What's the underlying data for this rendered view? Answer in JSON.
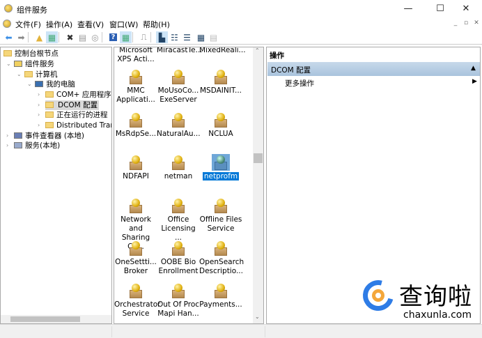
{
  "window": {
    "title": "组件服务",
    "minimize": "—",
    "maximize": "☐",
    "close": "✕"
  },
  "menu": [
    "文件(F)",
    "操作(A)",
    "查看(V)",
    "窗口(W)",
    "帮助(H)"
  ],
  "mdi": {
    "minimize": "_",
    "restore": "▫",
    "close": "✕"
  },
  "toolbar": [
    {
      "icon": "back-icon",
      "glyph": "⬅",
      "color": "#3a8ee6"
    },
    {
      "icon": "forward-icon",
      "glyph": "➡",
      "color": "#888"
    },
    {
      "icon": "up-folder-icon",
      "glyph": "▲",
      "color": "#e2b33c"
    },
    {
      "icon": "show-hide-tree-icon",
      "glyph": "▦",
      "color": "#4a7",
      "on": true
    },
    {
      "icon": "delete-icon",
      "glyph": "✖",
      "color": "#333"
    },
    {
      "icon": "properties-icon",
      "glyph": "▤",
      "color": "#999"
    },
    {
      "icon": "refresh-icon",
      "glyph": "◎",
      "color": "#999"
    },
    {
      "icon": "help-icon",
      "glyph": "?",
      "color": "#fff",
      "bg": "#2b5fb3"
    },
    {
      "icon": "show-action-pane-icon",
      "glyph": "▦",
      "color": "#4a7",
      "on": true
    },
    {
      "icon": "export-icon",
      "glyph": "⎍",
      "color": "#777"
    },
    {
      "icon": "large-icons-view-icon",
      "glyph": "▙",
      "color": "#246",
      "on": true
    },
    {
      "icon": "small-icons-view-icon",
      "glyph": "☷",
      "color": "#246"
    },
    {
      "icon": "list-view-icon",
      "glyph": "☰",
      "color": "#246"
    },
    {
      "icon": "detail-view-icon",
      "glyph": "▦",
      "color": "#246"
    },
    {
      "icon": "configure-icon",
      "glyph": "▤",
      "color": "#bbb"
    }
  ],
  "tree": [
    {
      "label": "控制台根节点",
      "level": 0,
      "arrow": ""
    },
    {
      "label": "组件服务",
      "level": 1,
      "arrow": "⌄"
    },
    {
      "label": "计算机",
      "level": 2,
      "arrow": "⌄"
    },
    {
      "label": "我的电脑",
      "level": 3,
      "arrow": "⌄"
    },
    {
      "label": "COM+ 应用程序",
      "level": 4,
      "arrow": "›"
    },
    {
      "label": "DCOM 配置",
      "level": 4,
      "arrow": "›",
      "selected": true
    },
    {
      "label": "正在运行的进程",
      "level": 4,
      "arrow": "›"
    },
    {
      "label": "Distributed Trans",
      "level": 4,
      "arrow": "›"
    },
    {
      "label": "事件查看器 (本地)",
      "level": 1,
      "arrow": "›"
    },
    {
      "label": "服务(本地)",
      "level": 1,
      "arrow": "›"
    }
  ],
  "items": [
    {
      "l1": "Microsoft",
      "l2": "XPS Acti...",
      "noicon": true
    },
    {
      "l1": "MiracastTe...",
      "l2": "",
      "noicon": true
    },
    {
      "l1": "MixedReali...",
      "l2": "",
      "noicon": true
    },
    {
      "l1": "MMC",
      "l2": "Applicati..."
    },
    {
      "l1": "MoUsoCo...",
      "l2": "ExeServer"
    },
    {
      "l1": "MSDAINIT...",
      "l2": ""
    },
    {
      "l1": "MsRdpSe...",
      "l2": ""
    },
    {
      "l1": "NaturalAu...",
      "l2": ""
    },
    {
      "l1": "NCLUA",
      "l2": ""
    },
    {
      "l1": "NDFAPI",
      "l2": ""
    },
    {
      "l1": "netman",
      "l2": ""
    },
    {
      "l1": "netprofm",
      "l2": "",
      "selected": true
    },
    {
      "l1": "Network and",
      "l2": "Sharing Ce..."
    },
    {
      "l1": "Office",
      "l2": "Licensing ..."
    },
    {
      "l1": "Offline Files",
      "l2": "Service"
    },
    {
      "l1": "OneSettti...",
      "l2": "Broker"
    },
    {
      "l1": "OOBE Bio",
      "l2": "Enrollment"
    },
    {
      "l1": "OpenSearch",
      "l2": "Descriptio..."
    },
    {
      "l1": "Orchestrator",
      "l2": "Service"
    },
    {
      "l1": "Out Of Proc",
      "l2": "Mapi Han..."
    },
    {
      "l1": "Payments...",
      "l2": ""
    }
  ],
  "actions": {
    "header": "操作",
    "section": "DCOM 配置",
    "collapse": "▲",
    "more": "更多操作",
    "more_arrow": "▶"
  },
  "watermark": {
    "brand": "查询啦",
    "url": "chaxunla.com"
  },
  "colors": {
    "selection": "#0078d7",
    "actionHeader": "#b9cfe4"
  }
}
